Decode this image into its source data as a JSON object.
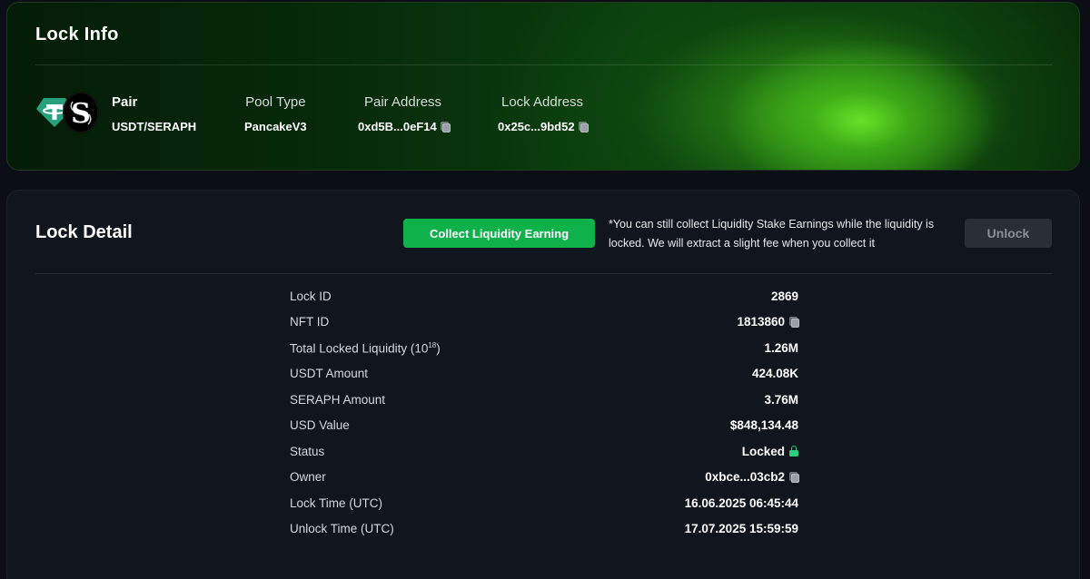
{
  "lock_info": {
    "title": "Lock Info",
    "pair": {
      "label": "Pair",
      "value": "USDT/SERAPH"
    },
    "pool_type": {
      "label": "Pool Type",
      "value": "PancakeV3"
    },
    "pair_address": {
      "label": "Pair Address",
      "value": "0xd5B...0eF14"
    },
    "lock_address": {
      "label": "Lock Address",
      "value": "0x25c...9bd52"
    },
    "icons": [
      "tether-icon",
      "seraph-icon",
      "copy-icon"
    ]
  },
  "lock_detail": {
    "title": "Lock Detail",
    "collect_button": "Collect Liquidity Earning",
    "collect_note": "*You can still collect Liquidity Stake Earnings while the liquidity is locked. We will extract a slight fee when you collect it",
    "unlock_button": "Unlock",
    "rows": [
      {
        "label": "Lock ID",
        "value": "2869"
      },
      {
        "label": "NFT ID",
        "value": "1813860"
      },
      {
        "label": "Total Locked Liquidity (10",
        "label_sup": "18",
        "label_suffix": ")",
        "value": "1.26M"
      },
      {
        "label": "USDT Amount",
        "value": "424.08K"
      },
      {
        "label": "SERAPH Amount",
        "value": "3.76M"
      },
      {
        "label": "USD Value",
        "value": "$848,134.48"
      },
      {
        "label": "Status",
        "value": "Locked"
      },
      {
        "label": "Owner",
        "value": "0xbce...03cb2"
      },
      {
        "label": "Lock Time (UTC)",
        "value": "16.06.2025 06:45:44"
      },
      {
        "label": "Unlock Time (UTC)",
        "value": "17.07.2025 15:59:59"
      }
    ]
  },
  "colors": {
    "background": "#0b0e14",
    "collect_button": "#0fb14b",
    "unlock_button": "#2a2e36",
    "tether": "#26a17b",
    "lock_status": "#26d07c"
  }
}
